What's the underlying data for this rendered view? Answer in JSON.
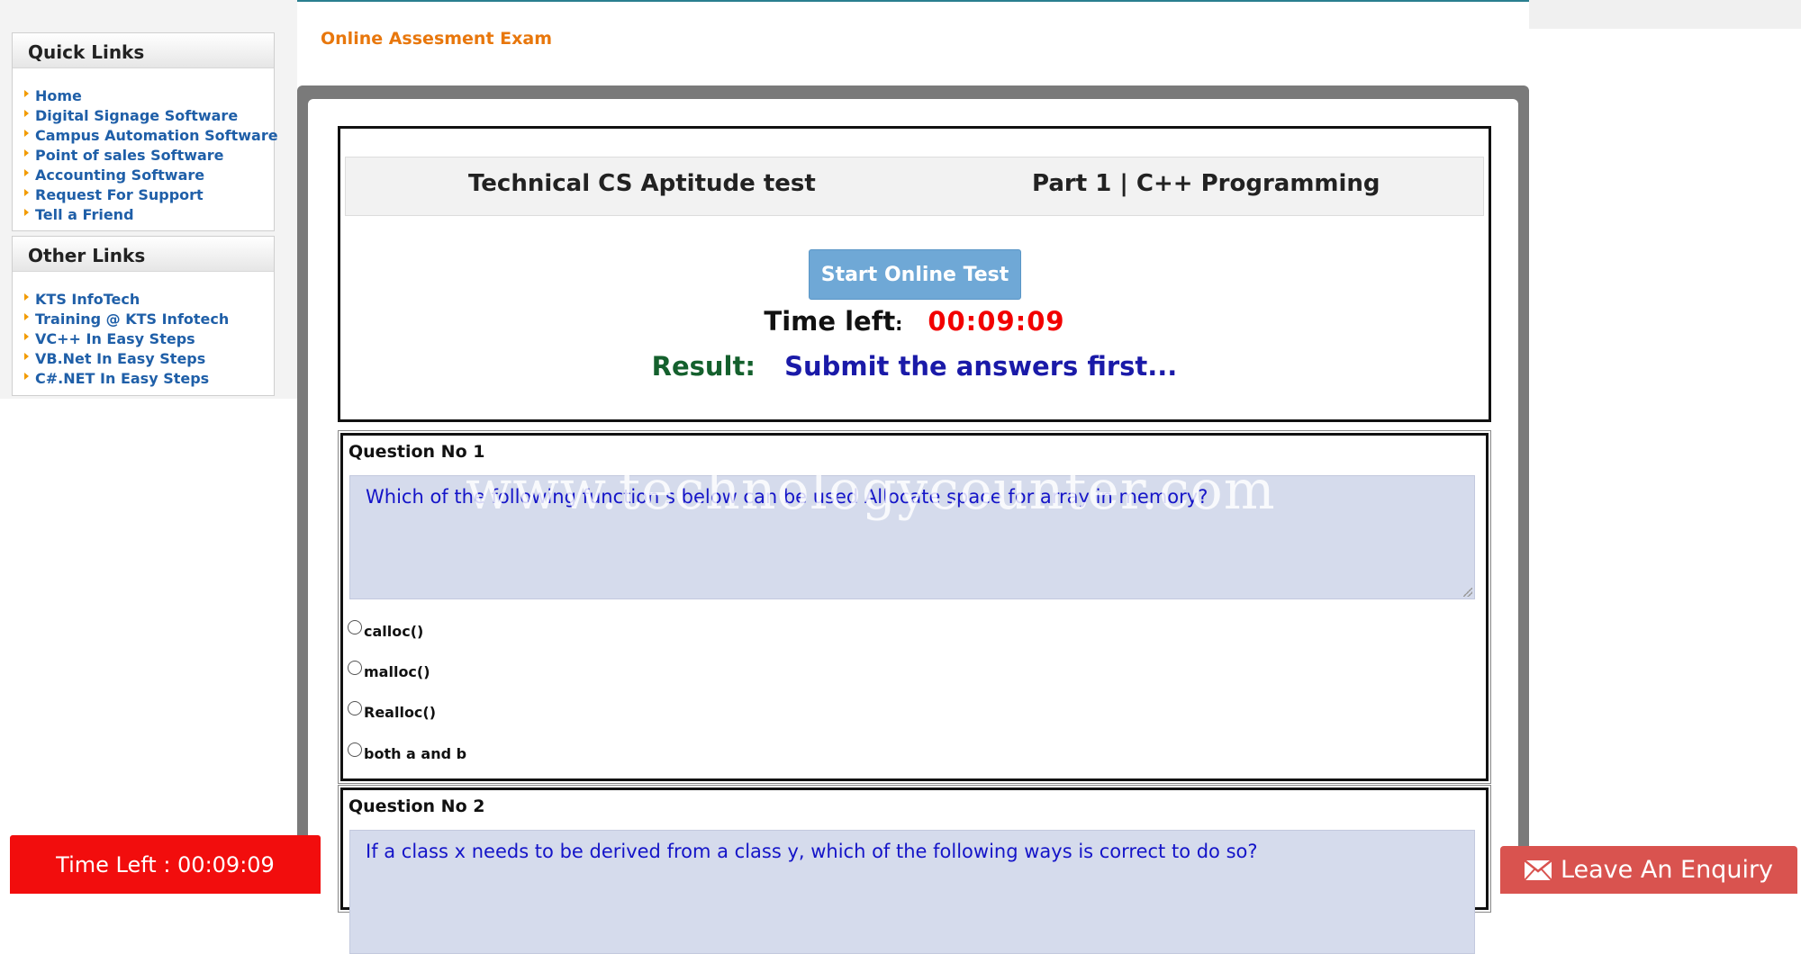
{
  "page": {
    "heading": "Online Assesment Exam"
  },
  "sidebar": {
    "quick_links": {
      "title": "Quick Links",
      "items": [
        {
          "label": "Home"
        },
        {
          "label": "Digital Signage Software"
        },
        {
          "label": "Campus Automation Software"
        },
        {
          "label": "Point of sales Software"
        },
        {
          "label": "Accounting Software"
        },
        {
          "label": "Request For Support"
        },
        {
          "label": "Tell a Friend"
        }
      ]
    },
    "other_links": {
      "title": "Other Links",
      "items": [
        {
          "label": "KTS InfoTech"
        },
        {
          "label": "Training @ KTS Infotech"
        },
        {
          "label": "VC++ In Easy Steps"
        },
        {
          "label": "VB.Net In Easy Steps"
        },
        {
          "label": "C#.NET In Easy Steps"
        }
      ]
    }
  },
  "exam": {
    "test_name": "Technical CS Aptitude test",
    "part": "Part 1 | C++ Programming",
    "start_button": "Start Online Test",
    "time_left_label": "Time left",
    "time_left_colon": ":",
    "time_left_value": "00:09:09",
    "result_label": "Result:",
    "result_value": "Submit the answers first..."
  },
  "questions": [
    {
      "title": "Question No 1",
      "text": "Which of the following function s below can be used Allocate space for array in memory?",
      "options": [
        "calloc()",
        "malloc()",
        "Realloc()",
        "both a and b"
      ]
    },
    {
      "title": "Question No 2",
      "text": "If a class x needs to be derived from a class y, which of the following ways is correct to do so?"
    }
  ],
  "watermark": "www.technologycounter.com",
  "timer_float": "Time Left : 00:09:09",
  "enquiry_button": "Leave An Enquiry",
  "colors": {
    "accent_orange": "#e8770c",
    "timer_red": "#f20000",
    "start_button_blue": "#6fa8d6",
    "result_green": "#14602d",
    "result_blue": "#1a1aa8",
    "enquiry_red": "#d9534f"
  }
}
